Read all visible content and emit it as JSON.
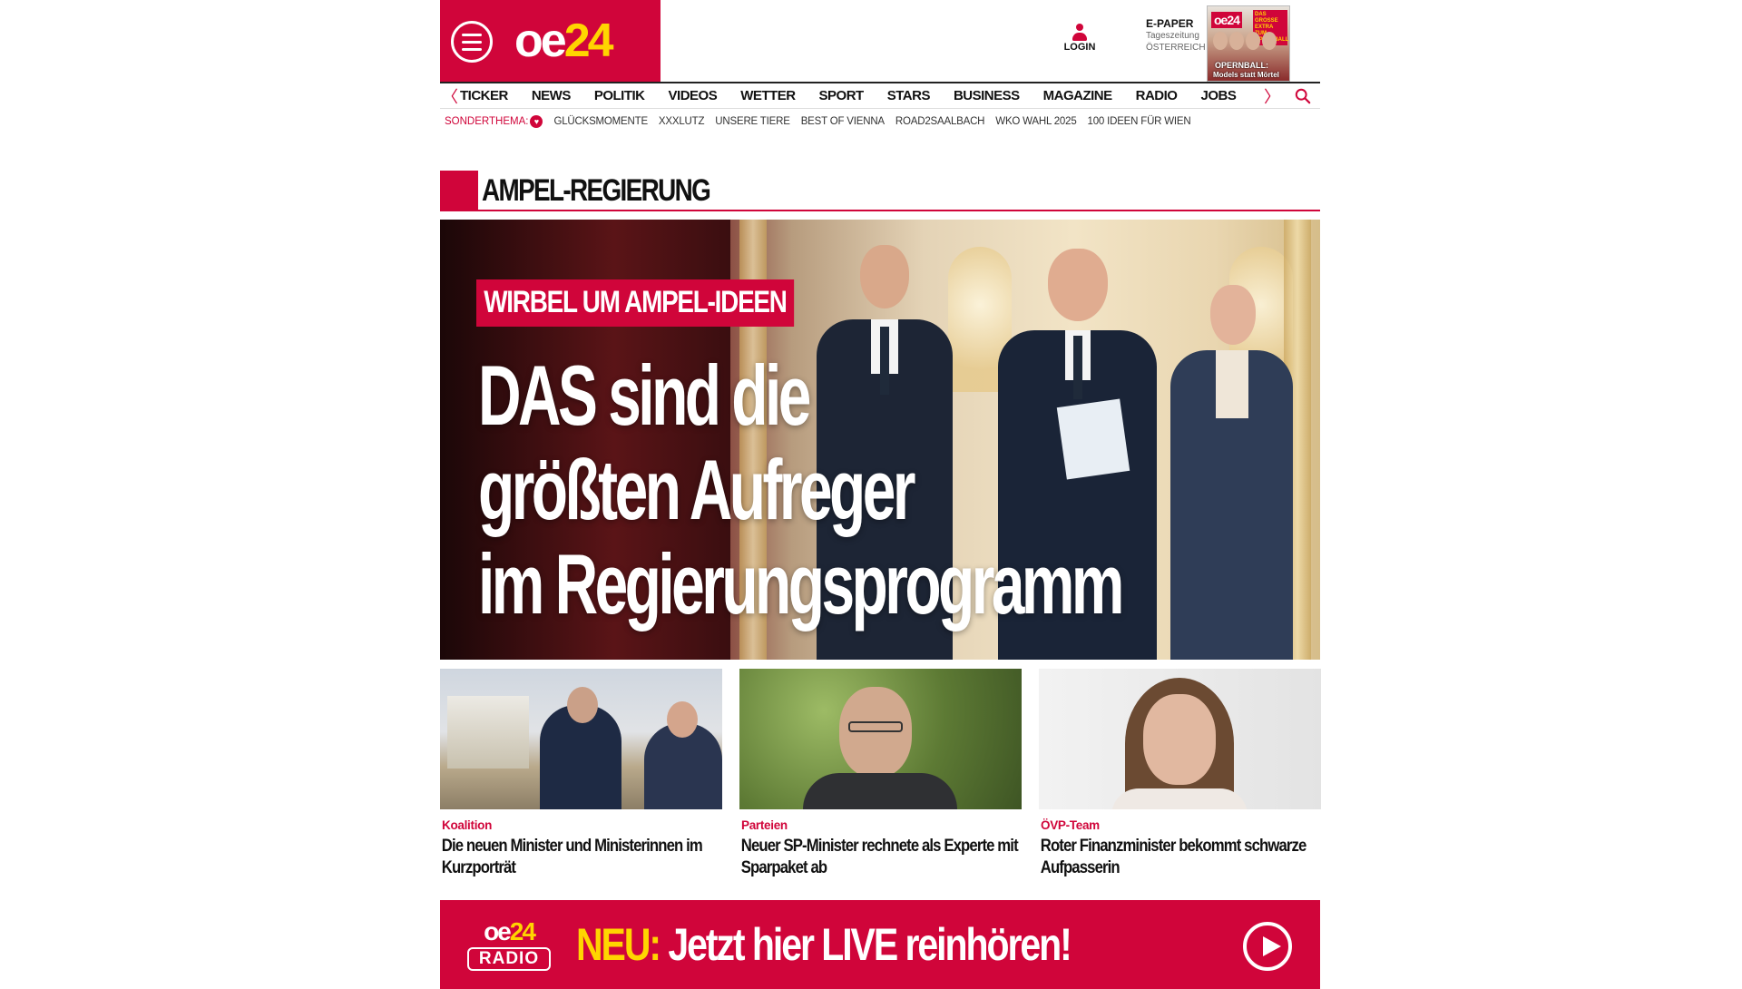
{
  "header": {
    "logo_oe": "oe",
    "logo_24": "24",
    "login_label": "LOGIN",
    "epaper_title": "E-PAPER",
    "epaper_sub1": "Tageszeitung",
    "epaper_sub2": "ÖSTERREICH",
    "cover_logo": "oe24",
    "cover_tag": "DAS GROSSE EXTRA ZUM OPERNBALL",
    "cover_line1": "OPERNBALL:",
    "cover_line2": "Models statt Mörtel"
  },
  "nav": {
    "items": [
      "TICKER",
      "NEWS",
      "POLITIK",
      "VIDEOS",
      "WETTER",
      "SPORT",
      "STARS",
      "BUSINESS",
      "MAGAZINE",
      "RADIO",
      "JOBS"
    ],
    "left_arrow": "〈",
    "right_arrow": "〉"
  },
  "subnav": {
    "label": "SONDERTHEMA:",
    "items": [
      "GLÜCKSMOMENTE",
      "XXXLUTZ",
      "UNSERE TIERE",
      "BEST OF VIENNA",
      "ROAD2SAALBACH",
      "WKO WAHL 2025",
      "100 IDEEN FÜR WIEN"
    ]
  },
  "section": {
    "title": "AMPEL-REGIERUNG"
  },
  "hero": {
    "kicker": "WIRBEL UM AMPEL-IDEEN",
    "headline_lines": [
      "DAS sind die",
      "größten Aufreger",
      "im Regierungsprogramm"
    ]
  },
  "cards": [
    {
      "category": "Koalition",
      "title": "Die neuen Minister und Ministerinnen im Kurzporträt"
    },
    {
      "category": "Parteien",
      "title": "Neuer SP-Minister rechnete als Experte mit Sparpaket ab"
    },
    {
      "category": "ÖVP-Team",
      "title": "Roter Finanzminister bekommt schwarze Aufpasserin"
    }
  ],
  "banner": {
    "logo_oe": "oe",
    "logo_24": "24",
    "logo_radio": "RADIO",
    "neu": "NEU:",
    "text": " Jetzt hier LIVE reinhören!"
  },
  "colors": {
    "brand": "#d0053a",
    "accent": "#ffd500"
  }
}
